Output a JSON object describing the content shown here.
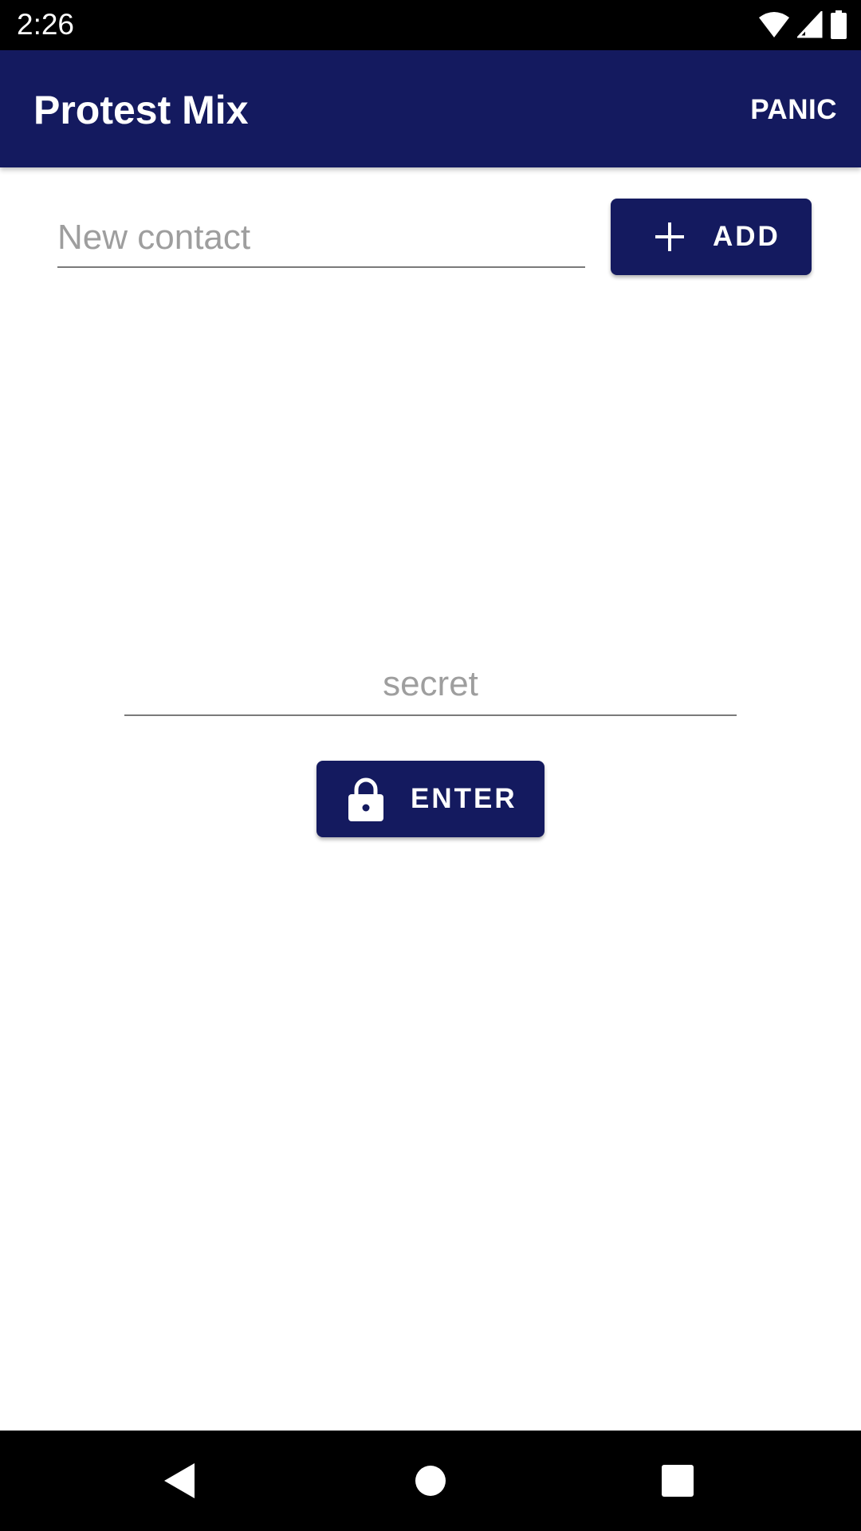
{
  "status_bar": {
    "time": "2:26",
    "icons": [
      "wifi-icon",
      "cell-signal-icon",
      "battery-icon"
    ]
  },
  "app_bar": {
    "title": "Protest Mix",
    "action_label": "PANIC",
    "background_color": "#141a5f"
  },
  "contact": {
    "placeholder": "New contact",
    "value": "",
    "add_label": "ADD",
    "add_icon": "plus-icon"
  },
  "secret": {
    "placeholder": "secret",
    "value": "",
    "enter_label": "ENTER",
    "enter_icon": "lock-icon"
  },
  "nav_bar": {
    "buttons": [
      "back-icon",
      "home-icon",
      "recents-icon"
    ]
  },
  "colors": {
    "primary": "#141a5f",
    "placeholder": "#9e9e9e",
    "underline": "#7a7a7a"
  }
}
